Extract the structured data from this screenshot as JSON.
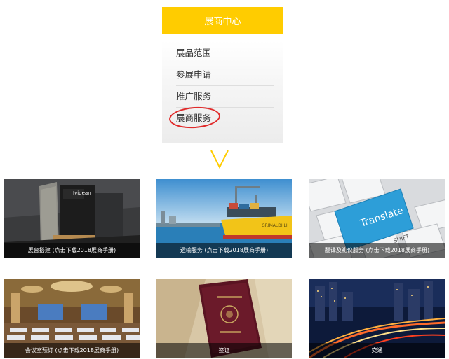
{
  "menu": {
    "title": "展商中心",
    "items": [
      {
        "label": "展品范围"
      },
      {
        "label": "参展申请"
      },
      {
        "label": "推广服务"
      },
      {
        "label": "展商服务"
      }
    ]
  },
  "tiles": [
    {
      "caption": "展台搭建 (点击下载2018展商手册)",
      "image_text": "Ividean"
    },
    {
      "caption": "运输服务 (点击下载2018展商手册)",
      "image_text": "GRIMALDI LI"
    },
    {
      "caption": "翻译及礼仪服务 (点击下载2018展商手册)",
      "image_text": "Translate",
      "image_text_2": "SHIFT"
    },
    {
      "caption": "会议室预订 (点击下载2018展商手册)"
    },
    {
      "caption": "签证"
    },
    {
      "caption": "交通"
    }
  ],
  "colors": {
    "accent": "#ffcc00",
    "highlight": "#e02a2a",
    "caption_bg": "rgba(0,0,0,0.55)"
  }
}
